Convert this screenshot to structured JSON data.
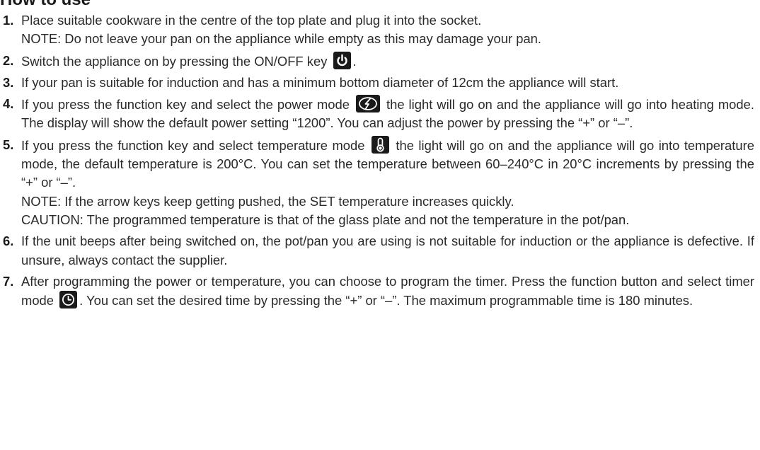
{
  "heading": "How to use",
  "steps": [
    {
      "num": "1.",
      "text": "Place suitable cookware in the centre of the top plate and plug it into the socket.",
      "note": "NOTE: Do not leave your pan on the appliance while empty as this may damage your pan."
    },
    {
      "num": "2.",
      "text": "Switch the appliance on by pressing the ON/OFF key",
      "after": ".",
      "icon": "power-icon"
    },
    {
      "num": "3.",
      "text": "If your pan is suitable for induction and has a minimum bottom diameter of 12cm the appliance will start."
    },
    {
      "num": "4.",
      "text_a": "If you press the function key and select the power mode",
      "text_b": "the light will go on and the appliance will go into heating mode. The display will show the default power setting “1200”. You can adjust the power by pressing the “+” or “–”.",
      "icon": "power-mode-icon"
    },
    {
      "num": "5.",
      "text_a": "If you press the function key and select temperature mode",
      "text_b": "the light will go on and the appliance will go into temperature mode, the default temperature is 200°C. You can set the temperature between 60–240°C in 20°C increments by pressing the “+” or “–”.",
      "note": "NOTE: If the arrow keys keep getting pushed, the SET temperature increases quickly.",
      "caution": "CAUTION: The programmed temperature is that of the glass plate and not the temperature in the pot/pan.",
      "icon": "thermometer-icon"
    },
    {
      "num": "6.",
      "text": "If the unit beeps after being switched on, the pot/pan you are using is not suitable for induction or the appliance is defective. If unsure, always contact the supplier."
    },
    {
      "num": "7.",
      "text_a": "After programming the power or temperature, you can choose to program the timer. Press the function button and select timer mode",
      "text_b": ". You can set the desired time by pressing the “+” or  “–”. The maximum programmable time is 180 minutes.",
      "icon": "timer-icon"
    }
  ]
}
